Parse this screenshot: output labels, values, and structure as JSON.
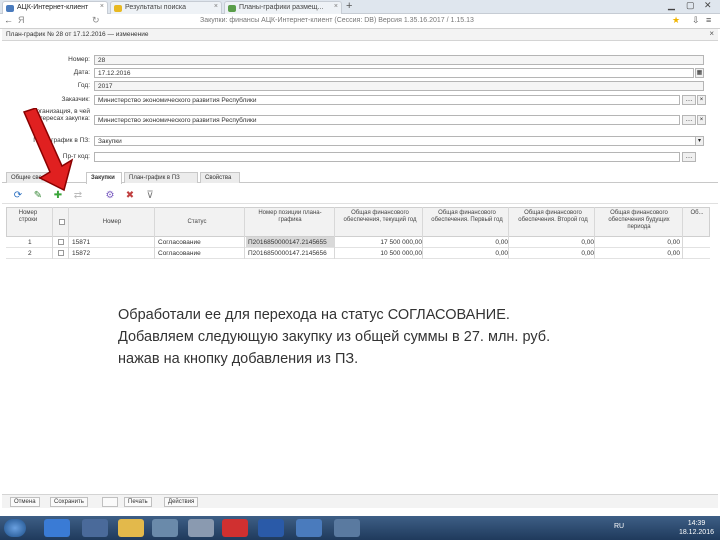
{
  "browser": {
    "tabs": [
      {
        "label": "АЦК-Интернет-клиент",
        "active": true
      },
      {
        "label": "Результаты поиска",
        "active": false
      },
      {
        "label": "Планы-графики размещ...",
        "active": false
      }
    ],
    "url": "Закупки: финансы  АЦК-Интернет-клиент (Сессия: DB)  Версия 1.35.16.2017 / 1.15.13"
  },
  "document": {
    "title": "План-график № 28 от 17.12.2016 — изменение",
    "fields": [
      {
        "label": "Номер:",
        "value": "28"
      },
      {
        "label": "Дата:",
        "value": "17.12.2016"
      },
      {
        "label": "Год:",
        "value": "2017"
      },
      {
        "label": "Заказчик:",
        "value": "Министерство экономического развития Республики"
      },
      {
        "label": "Организация, в чей интересах закупка:",
        "value": "Министерство экономического развития Республики"
      },
      {
        "label": "План-график в ПЗ:",
        "value": "Закупки"
      },
      {
        "label": "Пр-т код:",
        "value": ""
      }
    ]
  },
  "form_tabs": [
    {
      "label": "Общие сведения",
      "active": false
    },
    {
      "label": "Закупки",
      "active": true
    },
    {
      "label": "План-график в ПЗ",
      "active": false
    },
    {
      "label": "Свойства",
      "active": false
    }
  ],
  "grid": {
    "headers": [
      "Номер строки",
      "",
      "Номер",
      "Статус",
      "Номер позиции плана-графика",
      "Общая финансового обеспечения, текущий год",
      "Общая финансового обеспечения. Первый год",
      "Общая финансового обеспечения. Второй год",
      "Общая финансового обеспечения будущих периода",
      "Об..."
    ],
    "rows": [
      {
        "n": "1",
        "number": "15871",
        "status": "Согласование",
        "position": "П2016850000147.2145655",
        "current": "17 500 000,00",
        "y1": "0,00",
        "y2": "0,00",
        "future": "0,00"
      },
      {
        "n": "2",
        "number": "15872",
        "status": "Согласование",
        "position": "П2016850000147.2145656",
        "current": "10 500 000,00",
        "y1": "0,00",
        "y2": "0,00",
        "future": "0,00"
      }
    ]
  },
  "annotation": {
    "line1": "Обработали ее для перехода на статус СОГЛАСОВАНИЕ.",
    "line2": "Добавляем следующую закупку из общей суммы в 27. млн. руб.",
    "line3": "нажав на кнопку добавления из ПЗ."
  },
  "bottom_bar": {
    "buttons": [
      "Отмена",
      "Сохранить",
      "",
      "Печать",
      "Действия"
    ]
  },
  "taskbar": {
    "lang": "RU",
    "time": "14:39",
    "date": "18.12.2016"
  },
  "colors": {
    "arrow": "#e02020",
    "taskbar": "#1f3a5c"
  }
}
